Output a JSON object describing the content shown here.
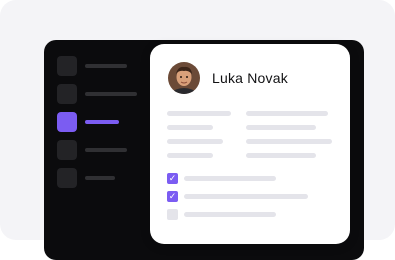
{
  "profile": {
    "name": "Luka Novak"
  },
  "colors": {
    "accent": "#7b5cf2",
    "window": "#0b0b0d",
    "skeleton": "#e4e4ea"
  },
  "sidebar": {
    "items": [
      {
        "active": false
      },
      {
        "active": false
      },
      {
        "active": true
      },
      {
        "active": false
      },
      {
        "active": false
      }
    ]
  },
  "checklist": [
    {
      "checked": true
    },
    {
      "checked": true
    },
    {
      "checked": false
    }
  ],
  "icons": {
    "avatar": "avatar-icon",
    "check": "check-icon"
  }
}
